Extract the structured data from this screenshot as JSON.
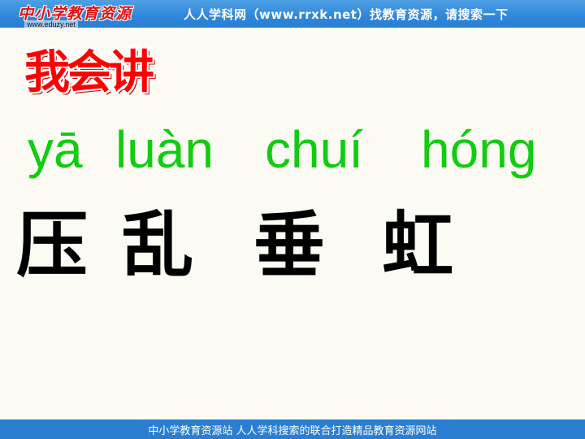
{
  "header": {
    "logo_text": "中小学教育资源",
    "logo_url": "www.eduzy.net",
    "banner": "人人学科网（www.rrxk.net）找教育资源，请搜索一下"
  },
  "title": "我会讲",
  "pinyin": [
    "yā",
    "luàn",
    "chuí",
    "hóng"
  ],
  "characters": [
    "压",
    "乱",
    "垂",
    "虹"
  ],
  "footer": {
    "text": "中小学教育资源站  人人学科搜索的联合打造精品教育资源网站"
  },
  "colors": {
    "bar": "#2a7ed2",
    "title": "#ff0000",
    "pinyin": "#11cc11",
    "characters": "#000000",
    "background": "#fbfbf3"
  }
}
